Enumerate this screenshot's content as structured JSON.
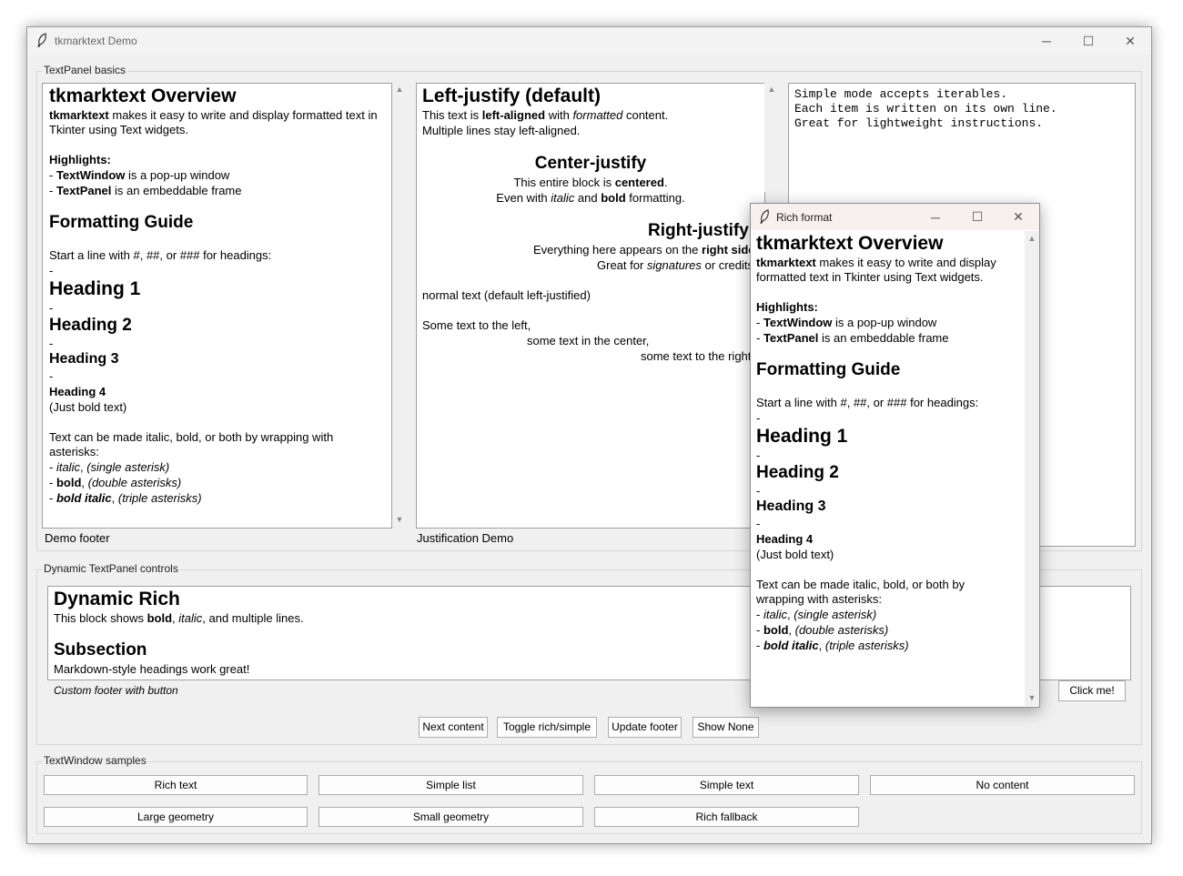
{
  "window": {
    "title": "tkmarktext Demo",
    "controls": {
      "minimize": "─",
      "maximize": "☐",
      "close": "✕"
    }
  },
  "basics": {
    "label": "TextPanel basics",
    "panel1": {
      "h_overview": "tkmarktext Overview",
      "intro_bold": "tkmarktext",
      "intro_rest": " makes it easy to write and display formatted text in",
      "intro_line2": "Tkinter using Text widgets.",
      "highlights": "Highlights:",
      "hl1_pre": "- ",
      "hl1_bold": "TextWindow",
      "hl1_rest": " is a pop-up window",
      "hl2_pre": "- ",
      "hl2_bold": "TextPanel",
      "hl2_rest": " is an embeddable frame",
      "h_guide": "Formatting Guide",
      "start_line": "Start a line with #, ##, or ### for headings:",
      "dash": "-",
      "heading1": "Heading 1",
      "heading2": "Heading 2",
      "heading3": "Heading 3",
      "heading4": "Heading 4",
      "just_bold": "(Just bold text)",
      "italic_line1": "Text can be made italic, bold, or both by wrapping with",
      "italic_line2": "asterisks:",
      "ex1_a": "- ",
      "ex1_b": "italic",
      "ex1_c": ", ",
      "ex1_d": "(single asterisk)",
      "ex2_a": "- ",
      "ex2_b": "bold",
      "ex2_c": ", ",
      "ex2_d": "(double asterisks)",
      "ex3_a": "- ",
      "ex3_b": "bold italic",
      "ex3_c": ", ",
      "ex3_d": "(triple asterisks)",
      "footer": "Demo footer"
    },
    "panel2": {
      "h_left": "Left-justify (default)",
      "l1a": "This text is ",
      "l1b": "left-aligned",
      "l1c": " with ",
      "l1d": "formatted",
      "l1e": " content.",
      "l2": "Multiple lines stay left-aligned.",
      "h_center": "Center-justify",
      "c1a": "This entire block is ",
      "c1b": "centered",
      "c1c": ".",
      "c2a": "Even with ",
      "c2b": "italic",
      "c2c": " and ",
      "c2d": "bold",
      "c2e": " formatting.",
      "h_right": "Right-justify",
      "r1a": "Everything here appears on the ",
      "r1b": "right side",
      "r2a": "Great for ",
      "r2b": "signatures",
      "r2c": " or credits",
      "normal": "normal text (default left-justified)",
      "m1": "Some text to the left,",
      "m2": "some text in the center,",
      "m3": "some text to the right",
      "footer": "Justification Demo"
    },
    "panel3": {
      "lines": [
        "Simple mode accepts iterables.",
        "Each item is written on its own line.",
        "Great for lightweight instructions."
      ]
    }
  },
  "dynamic": {
    "label": "Dynamic TextPanel controls",
    "h_rich": "Dynamic Rich",
    "p1a": "This block shows ",
    "p1b": "bold",
    "p1c": ", ",
    "p1d": "italic",
    "p1e": ", and multiple lines.",
    "h_sub": "Subsection",
    "p2": "Markdown-style headings work great!",
    "footer": "Custom footer with button",
    "click_button": "Click me!",
    "buttons": [
      "Next content",
      "Toggle rich/simple",
      "Update footer",
      "Show None"
    ]
  },
  "samples": {
    "label": "TextWindow samples",
    "buttons": [
      "Rich text",
      "Simple list",
      "Simple text",
      "No content",
      "Large geometry",
      "Small geometry",
      "Rich fallback"
    ]
  },
  "popup": {
    "title": "Rich format",
    "h_overview": "tkmarktext Overview",
    "intro_bold": "tkmarktext",
    "intro_rest": " makes it easy to write and display",
    "intro_line2": "formatted text in Tkinter using Text widgets.",
    "highlights": "Highlights:",
    "hl1_pre": "- ",
    "hl1_bold": "TextWindow",
    "hl1_rest": " is a pop-up window",
    "hl2_pre": "- ",
    "hl2_bold": "TextPanel",
    "hl2_rest": " is an embeddable frame",
    "h_guide": "Formatting Guide",
    "start_line": "Start a line with #, ##, or ### for headings:",
    "dash": "-",
    "heading1": "Heading 1",
    "heading2": "Heading 2",
    "heading3": "Heading 3",
    "heading4": "Heading 4",
    "just_bold": "(Just bold text)",
    "italic_line1": "Text can be made italic, bold, or both by",
    "italic_line2": "wrapping with asterisks:",
    "ex1_a": "- ",
    "ex1_b": "italic",
    "ex1_c": ", ",
    "ex1_d": "(single asterisk)",
    "ex2_a": "- ",
    "ex2_b": "bold",
    "ex2_c": ", ",
    "ex2_d": "(double asterisks)",
    "ex3_a": "- ",
    "ex3_b": "bold italic",
    "ex3_c": ", ",
    "ex3_d": "(triple asterisks)"
  },
  "icons": {
    "app": "feather-icon",
    "scroll_up": "scroll-up-arrow-icon",
    "scroll_down": "scroll-down-arrow-icon"
  }
}
